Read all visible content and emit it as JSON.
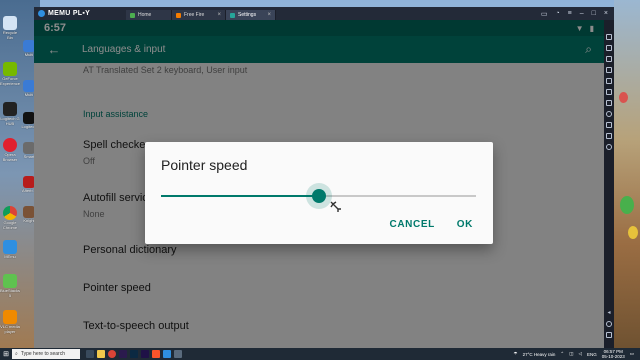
{
  "emulator": {
    "brand": "MEMU PL▪Y",
    "tabs": [
      {
        "label": "Home",
        "color": "#4caf50"
      },
      {
        "label": "Free Fire",
        "color": "#f57c00"
      },
      {
        "label": "Settings",
        "color": "#26a69a"
      }
    ]
  },
  "desktop": {
    "icons": [
      "Recycle Bin",
      "GeForce Experience",
      "Logitech G HUB",
      "Opera Browser",
      "Google Chrome",
      "MEmu",
      "BlueStacks 5",
      "VLC media player"
    ],
    "icons2": [
      "Multi",
      "Multi",
      "Logitech",
      "Smart",
      "Knight",
      "Afterb..."
    ]
  },
  "android": {
    "status_time": "6:57",
    "appbar_title": "Languages & input",
    "partial_summary": "AT Translated Set 2 keyboard, User input",
    "category": "Input assistance",
    "items": [
      {
        "title": "Spell checker",
        "summary": "Off"
      },
      {
        "title": "Autofill service",
        "summary": "None"
      },
      {
        "title": "Personal dictionary",
        "summary": ""
      },
      {
        "title": "Pointer speed",
        "summary": ""
      },
      {
        "title": "Text-to-speech output",
        "summary": ""
      }
    ]
  },
  "dialog": {
    "title": "Pointer speed",
    "slider_value": 0.5,
    "cancel_label": "CANCEL",
    "ok_label": "OK"
  },
  "taskbar": {
    "search_placeholder": "Type here to search",
    "weather": "27°C  Heavy rain",
    "language": "ENG",
    "time": "06:57 PM",
    "date": "05-10-2023"
  },
  "colors": {
    "accent": "#00796b",
    "status_bar": "#00695c"
  }
}
